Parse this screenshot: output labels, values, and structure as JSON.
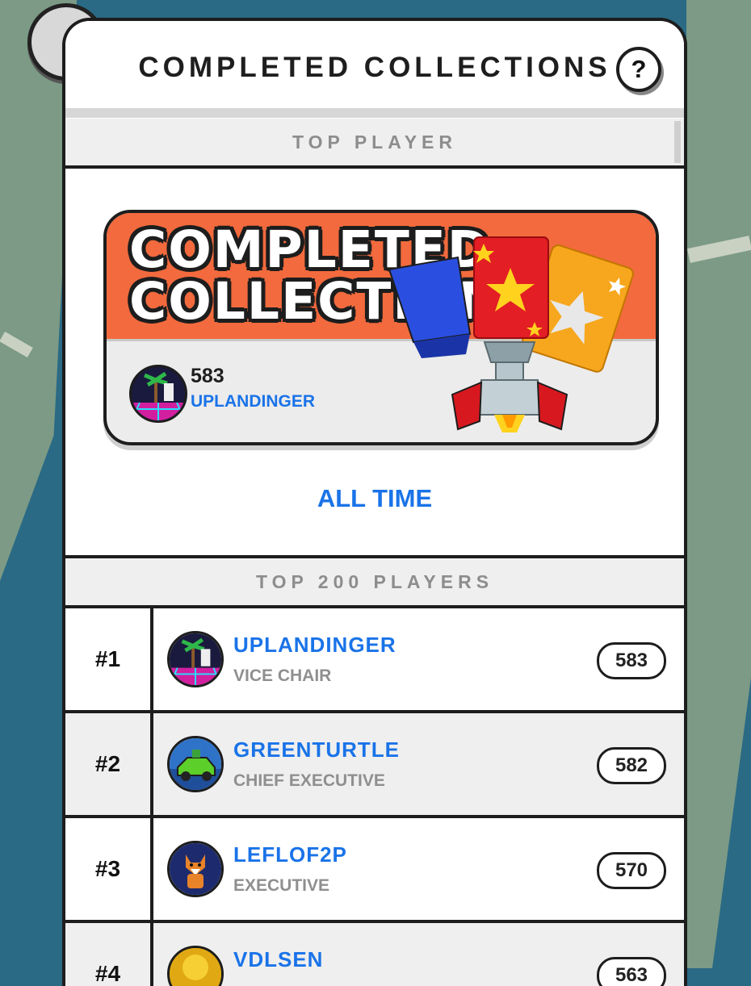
{
  "panel": {
    "title": "COMPLETED COLLECTIONS",
    "help_label": "?"
  },
  "top_player_section": {
    "label": "TOP PLAYER",
    "card": {
      "title_line1": "COMPLETED",
      "title_line2": "COLLECTIONS",
      "score": "583",
      "player": "UPLANDINGER"
    },
    "period": "ALL TIME"
  },
  "leaderboard": {
    "label": "TOP 200 PLAYERS",
    "rows": [
      {
        "rank": "#1",
        "name": "UPLANDINGER",
        "title": "VICE CHAIR",
        "score": "583",
        "avatar": "palm-synthwave-avatar"
      },
      {
        "rank": "#2",
        "name": "GREENTURTLE",
        "title": "CHIEF EXECUTIVE",
        "score": "582",
        "avatar": "green-car-avatar"
      },
      {
        "rank": "#3",
        "name": "LEFLOF2P",
        "title": "EXECUTIVE",
        "score": "570",
        "avatar": "fox-avatar"
      },
      {
        "rank": "#4",
        "name": "VDLSEN",
        "title": "",
        "score": "563",
        "avatar": "gold-coin-avatar"
      }
    ]
  },
  "colors": {
    "accent_blue": "#1a73e8",
    "hero_orange": "#f26a3d",
    "section_gray": "#efefef",
    "map_water": "#2a6a85",
    "map_land": "#7c9a85"
  }
}
